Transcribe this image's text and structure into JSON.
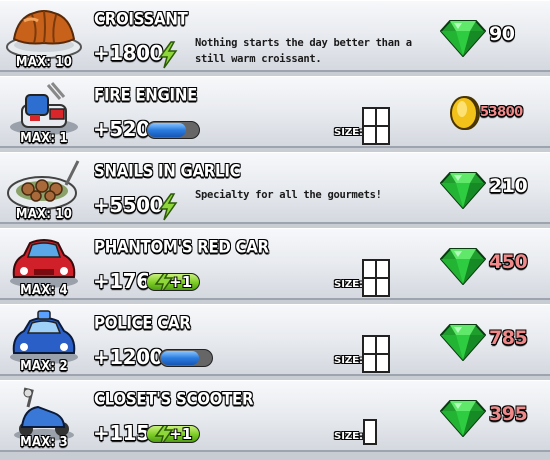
{
  "items": [
    {
      "name": "CROISSANT",
      "max": "MAX: 10",
      "value": "+1800",
      "description": "Nothing starts the day better than a still warm croissant.",
      "size_label": "",
      "size_cells": null,
      "currency": "gem",
      "price": "90",
      "price_color": "white",
      "indicator": "bolt",
      "icon": "croissant-icon"
    },
    {
      "name": "FIRE ENGINE",
      "max": "MAX: 1",
      "value": "+520",
      "description": "",
      "size_label": "SIZE:",
      "size_cells": 4,
      "currency": "coin",
      "price": "53800",
      "price_color": "pink",
      "indicator": "blue-bar",
      "icon": "fire-engine-icon"
    },
    {
      "name": "SNAILS IN GARLIC",
      "max": "MAX: 10",
      "value": "+5500",
      "description": "Specialty for all the gourmets!",
      "size_label": "",
      "size_cells": null,
      "currency": "gem",
      "price": "210",
      "price_color": "white",
      "indicator": "bolt",
      "icon": "snails-dish-icon"
    },
    {
      "name": "PHANTOM'S RED CAR",
      "max": "MAX: 4",
      "value": "+176",
      "description": "",
      "size_label": "SIZE:",
      "size_cells": 4,
      "currency": "gem",
      "price": "450",
      "price_color": "pink",
      "indicator": "green-bar",
      "bonus": "+1",
      "icon": "red-car-icon"
    },
    {
      "name": "POLICE CAR",
      "max": "MAX: 2",
      "value": "+1200",
      "description": "",
      "size_label": "SIZE:",
      "size_cells": 4,
      "currency": "gem",
      "price": "785",
      "price_color": "pink",
      "indicator": "blue-bar",
      "icon": "police-car-icon"
    },
    {
      "name": "CLOSET'S SCOOTER",
      "max": "MAX: 3",
      "value": "+115",
      "description": "",
      "size_label": "SIZE:",
      "size_cells": 1,
      "currency": "gem",
      "price": "395",
      "price_color": "pink",
      "indicator": "green-bar",
      "bonus": "+1",
      "icon": "scooter-icon"
    }
  ],
  "colors": {
    "gem": "#2ecc40",
    "coin": "#f2c21b",
    "price_pink": "#f08a8a",
    "bar_blue": "#2b7de0",
    "bar_green": "#7ccc24"
  }
}
